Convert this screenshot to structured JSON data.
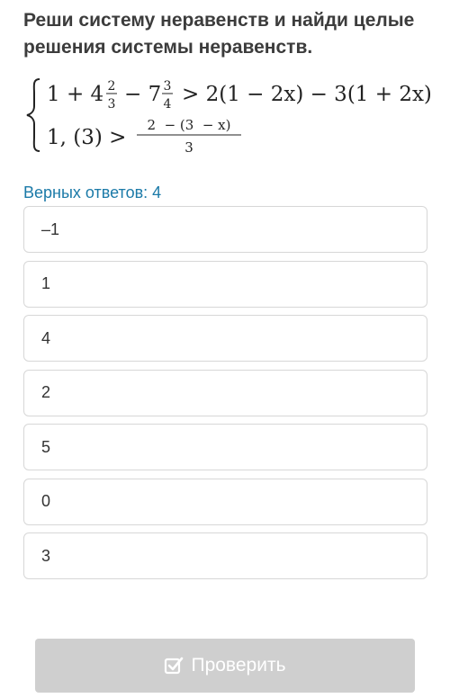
{
  "task": {
    "title": "Реши систему неравенств и найди целые решения системы неравенств."
  },
  "system": {
    "line1": {
      "a": "1 + 4",
      "f1_num": "2",
      "f1_den": "3",
      "b": "− 7",
      "f2_num": "3",
      "f2_den": "4",
      "c": "> 2(1 − 2x) − 3(1 + 2x)"
    },
    "line2": {
      "a": "1, (3) >",
      "frac_num": "2  − (3  − x)",
      "frac_den": "3"
    }
  },
  "hint": "Верных ответов: 4",
  "options": [
    "–1",
    "1",
    "4",
    "2",
    "5",
    "0",
    "3"
  ],
  "button": {
    "label": "Проверить",
    "icon": "checkbox-icon"
  },
  "colors": {
    "hint": "#1b7aa8",
    "button_bg": "#cfcfcf",
    "option_border": "#d7d7d7"
  }
}
